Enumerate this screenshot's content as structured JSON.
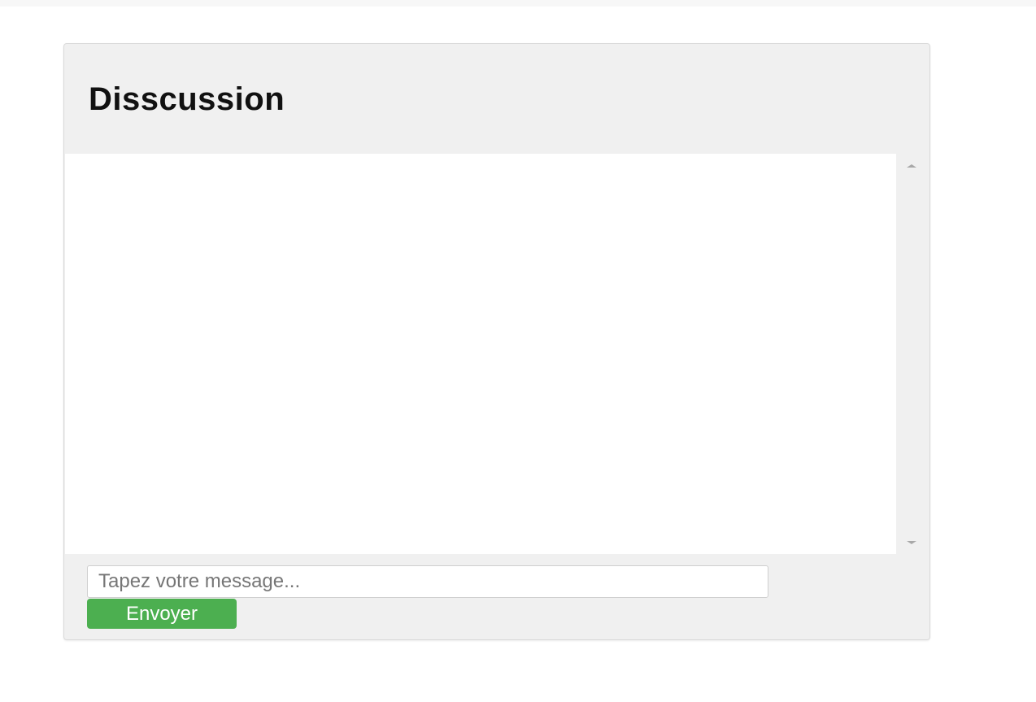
{
  "chat": {
    "title": "Disscussion",
    "messages": [],
    "input": {
      "value": "",
      "placeholder": "Tapez votre message..."
    },
    "send_label": "Envoyer"
  },
  "colors": {
    "panel_background": "#f0f0f0",
    "send_button": "#4caf50",
    "title_text": "#111111"
  }
}
